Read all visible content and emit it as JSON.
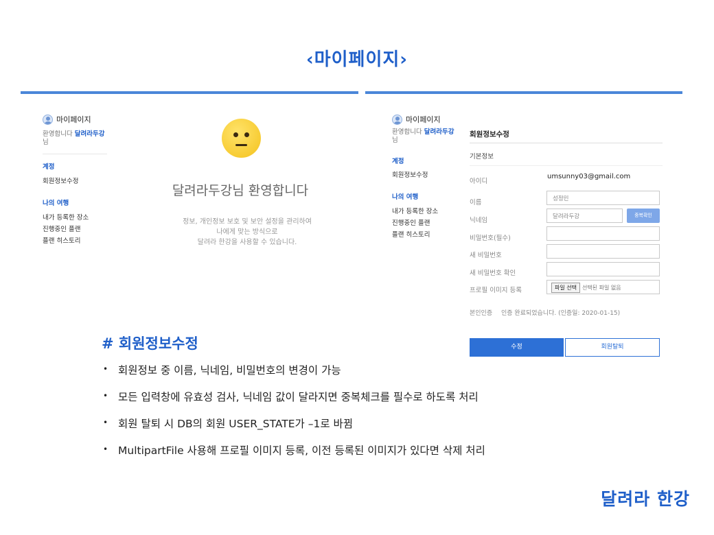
{
  "slide_title": "‹마이페이지›",
  "sidebar": {
    "title": "마이페이지",
    "welcome_prefix": "환영합니다",
    "welcome_name": "달려라두강",
    "welcome_suffix": "님",
    "group_account": "계정",
    "item_edit": "회원정보수정",
    "group_trips": "나의 여행",
    "item_places": "내가 등록한 장소",
    "item_plans": "진행중인 플랜",
    "item_history": "플랜 히스토리"
  },
  "left_panel": {
    "welcome_heading": "달려라두강님 환영합니다",
    "desc_line1": "정보, 개인정보 보호 및 보안 설정을 관리하여",
    "desc_line2": "나에게 맞는 방식으로",
    "desc_line3": "달려라 한강을 사용할 수 있습니다."
  },
  "form": {
    "title": "회원정보수정",
    "section": "기본정보",
    "id_label": "아이디",
    "id_value": "umsunny03@gmail.com",
    "name_label": "이름",
    "name_value": "성정민",
    "nickname_label": "닉네임",
    "nickname_value": "달려라두강",
    "dup_check": "중복확인",
    "password_label": "비밀번호(필수)",
    "new_password_label": "새 비밀번호",
    "new_password_confirm_label": "새 비밀번호 확인",
    "profile_label": "프로필 이미지 등록",
    "file_button": "파일 선택",
    "file_status": "선택된 파일 없음",
    "verify_label": "본인인증",
    "verify_status": "인증 완료되었습니다. (인증일: 2020-01-15)",
    "submit": "수정",
    "withdraw": "회원탈퇴"
  },
  "section_heading": "# 회원정보수정",
  "bullets": [
    "회원정보 중 이름, 닉네임, 비밀번호의 변경이 가능",
    "모든 입력창에 유효성 검사, 닉네임 값이 달라지면 중복체크를 필수로 하도록 처리",
    "회원 탈퇴 시 DB의 회원 USER_STATE가 –1로 바뀜",
    "MultipartFile 사용해 프로필 이미지 등록, 이전 등록된 이미지가 있다면 삭제 처리"
  ],
  "bullet_marker": "•",
  "brand": "달려라 한강",
  "colors": {
    "accent": "#1f5fc9",
    "rule": "#4a86d9",
    "button": "#2d70d6"
  }
}
